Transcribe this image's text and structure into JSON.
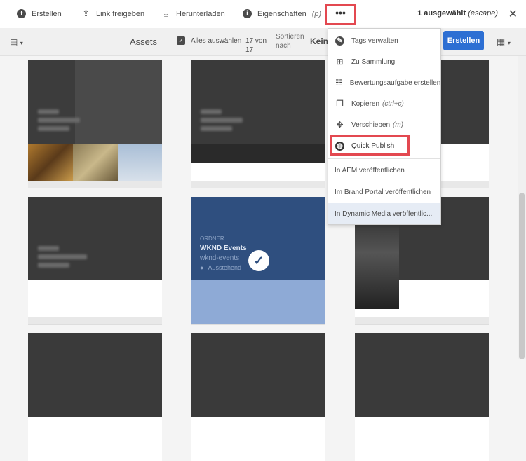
{
  "toolbar": {
    "create": "Erstellen",
    "share_link": "Link freigeben",
    "download": "Herunterladen",
    "properties": "Eigenschaften",
    "properties_shortcut": "(p)",
    "more": "•••",
    "selected": "1 ausgewählt",
    "selected_hint": "(escape)",
    "close": "✕"
  },
  "subbar": {
    "title": "Assets",
    "select_all": "Alles auswählen",
    "count_line1": "17 von",
    "count_line2": "17",
    "sort_line1": "Sortieren",
    "sort_line2": "nach",
    "sort_value": "Kein",
    "create_button": "Erstellen"
  },
  "menu": {
    "items": [
      {
        "label": "Tags verwalten",
        "icon": "tag-icon"
      },
      {
        "label": "Zu Sammlung",
        "icon": "collection-icon"
      },
      {
        "label": "Bewertungsaufgabe erstellen",
        "icon": "review-task-icon"
      },
      {
        "label": "Kopieren",
        "shortcut": "(ctrl+c)",
        "icon": "copy-icon"
      },
      {
        "label": "Verschieben",
        "shortcut": "(m)",
        "icon": "move-icon"
      },
      {
        "label": "Quick Publish",
        "icon": "globe-icon"
      }
    ],
    "submenu": [
      "In AEM veröffentlichen",
      "Im Brand Portal veröffentlichen",
      "In Dynamic Media veröffentlic..."
    ]
  },
  "selected_card": {
    "type": "ORDNER",
    "title": "WKND Events",
    "name": "wknd-events",
    "status": "Ausstehend"
  },
  "colors": {
    "accent": "#2d6fd3",
    "highlight": "#e34850",
    "selected_dark": "#2f4f7f",
    "selected_light": "#8eaad6"
  }
}
